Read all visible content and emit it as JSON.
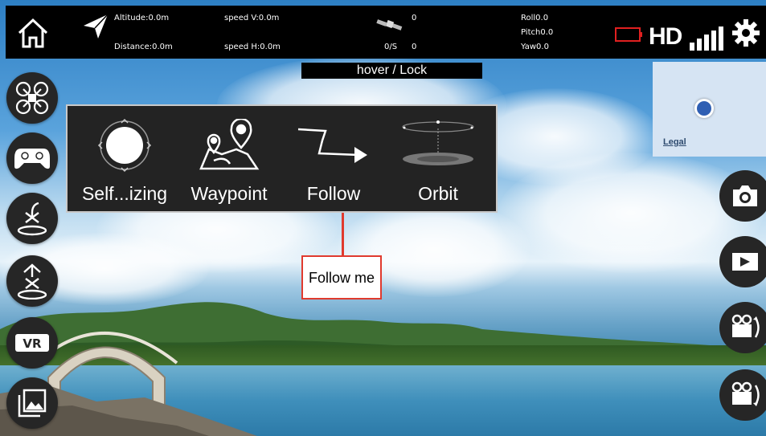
{
  "telemetry": {
    "altitude": "Altitude:0.0m",
    "distance": "Distance:0.0m",
    "speed_v": "speed V:0.0m",
    "speed_h": "speed H:0.0m",
    "satellites": "0",
    "rate_unit": "0/S",
    "rate_value": "0",
    "roll": "Roll0.0",
    "pitch": "Pitch0.0",
    "yaw": "Yaw0.0",
    "hd_label": "HD"
  },
  "status": {
    "hover_lock": "hover / Lock"
  },
  "flight_modes": [
    {
      "label": "Self...izing",
      "icon": "self-stabilizing-icon"
    },
    {
      "label": "Waypoint",
      "icon": "waypoint-map-icon"
    },
    {
      "label": "Follow",
      "icon": "follow-arrow-icon"
    },
    {
      "label": "Orbit",
      "icon": "orbit-icon"
    }
  ],
  "tooltip": {
    "text": "Follow me"
  },
  "map": {
    "legal": "Legal"
  },
  "left_buttons": [
    "drone-icon",
    "gamepad-icon",
    "landing-icon",
    "takeoff-icon",
    "vr-icon",
    "gallery-icon"
  ],
  "right_buttons": [
    "camera-icon",
    "video-icon",
    "camera-rotate-icon",
    "camera-rotate-icon"
  ],
  "colors": {
    "accent_red": "#e03a2e",
    "battery_red": "#e02020",
    "map_dot": "#2f5fb3"
  }
}
